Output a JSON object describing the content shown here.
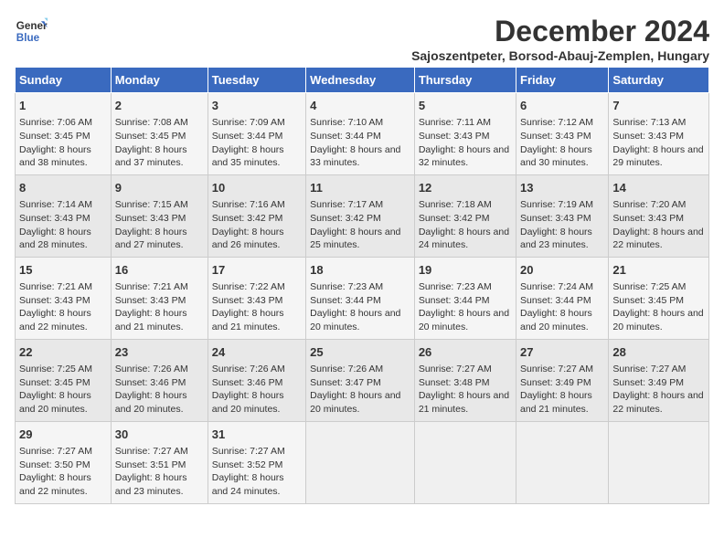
{
  "logo": {
    "line1": "General",
    "line2": "Blue"
  },
  "title": "December 2024",
  "subtitle": "Sajoszentpeter, Borsod-Abauj-Zemplen, Hungary",
  "days_of_week": [
    "Sunday",
    "Monday",
    "Tuesday",
    "Wednesday",
    "Thursday",
    "Friday",
    "Saturday"
  ],
  "weeks": [
    [
      {
        "day": 1,
        "sunrise": "7:06 AM",
        "sunset": "3:45 PM",
        "daylight": "8 hours and 38 minutes."
      },
      {
        "day": 2,
        "sunrise": "7:08 AM",
        "sunset": "3:45 PM",
        "daylight": "8 hours and 37 minutes."
      },
      {
        "day": 3,
        "sunrise": "7:09 AM",
        "sunset": "3:44 PM",
        "daylight": "8 hours and 35 minutes."
      },
      {
        "day": 4,
        "sunrise": "7:10 AM",
        "sunset": "3:44 PM",
        "daylight": "8 hours and 33 minutes."
      },
      {
        "day": 5,
        "sunrise": "7:11 AM",
        "sunset": "3:43 PM",
        "daylight": "8 hours and 32 minutes."
      },
      {
        "day": 6,
        "sunrise": "7:12 AM",
        "sunset": "3:43 PM",
        "daylight": "8 hours and 30 minutes."
      },
      {
        "day": 7,
        "sunrise": "7:13 AM",
        "sunset": "3:43 PM",
        "daylight": "8 hours and 29 minutes."
      }
    ],
    [
      {
        "day": 8,
        "sunrise": "7:14 AM",
        "sunset": "3:43 PM",
        "daylight": "8 hours and 28 minutes."
      },
      {
        "day": 9,
        "sunrise": "7:15 AM",
        "sunset": "3:43 PM",
        "daylight": "8 hours and 27 minutes."
      },
      {
        "day": 10,
        "sunrise": "7:16 AM",
        "sunset": "3:42 PM",
        "daylight": "8 hours and 26 minutes."
      },
      {
        "day": 11,
        "sunrise": "7:17 AM",
        "sunset": "3:42 PM",
        "daylight": "8 hours and 25 minutes."
      },
      {
        "day": 12,
        "sunrise": "7:18 AM",
        "sunset": "3:42 PM",
        "daylight": "8 hours and 24 minutes."
      },
      {
        "day": 13,
        "sunrise": "7:19 AM",
        "sunset": "3:43 PM",
        "daylight": "8 hours and 23 minutes."
      },
      {
        "day": 14,
        "sunrise": "7:20 AM",
        "sunset": "3:43 PM",
        "daylight": "8 hours and 22 minutes."
      }
    ],
    [
      {
        "day": 15,
        "sunrise": "7:21 AM",
        "sunset": "3:43 PM",
        "daylight": "8 hours and 22 minutes."
      },
      {
        "day": 16,
        "sunrise": "7:21 AM",
        "sunset": "3:43 PM",
        "daylight": "8 hours and 21 minutes."
      },
      {
        "day": 17,
        "sunrise": "7:22 AM",
        "sunset": "3:43 PM",
        "daylight": "8 hours and 21 minutes."
      },
      {
        "day": 18,
        "sunrise": "7:23 AM",
        "sunset": "3:44 PM",
        "daylight": "8 hours and 20 minutes."
      },
      {
        "day": 19,
        "sunrise": "7:23 AM",
        "sunset": "3:44 PM",
        "daylight": "8 hours and 20 minutes."
      },
      {
        "day": 20,
        "sunrise": "7:24 AM",
        "sunset": "3:44 PM",
        "daylight": "8 hours and 20 minutes."
      },
      {
        "day": 21,
        "sunrise": "7:25 AM",
        "sunset": "3:45 PM",
        "daylight": "8 hours and 20 minutes."
      }
    ],
    [
      {
        "day": 22,
        "sunrise": "7:25 AM",
        "sunset": "3:45 PM",
        "daylight": "8 hours and 20 minutes."
      },
      {
        "day": 23,
        "sunrise": "7:26 AM",
        "sunset": "3:46 PM",
        "daylight": "8 hours and 20 minutes."
      },
      {
        "day": 24,
        "sunrise": "7:26 AM",
        "sunset": "3:46 PM",
        "daylight": "8 hours and 20 minutes."
      },
      {
        "day": 25,
        "sunrise": "7:26 AM",
        "sunset": "3:47 PM",
        "daylight": "8 hours and 20 minutes."
      },
      {
        "day": 26,
        "sunrise": "7:27 AM",
        "sunset": "3:48 PM",
        "daylight": "8 hours and 21 minutes."
      },
      {
        "day": 27,
        "sunrise": "7:27 AM",
        "sunset": "3:49 PM",
        "daylight": "8 hours and 21 minutes."
      },
      {
        "day": 28,
        "sunrise": "7:27 AM",
        "sunset": "3:49 PM",
        "daylight": "8 hours and 22 minutes."
      }
    ],
    [
      {
        "day": 29,
        "sunrise": "7:27 AM",
        "sunset": "3:50 PM",
        "daylight": "8 hours and 22 minutes."
      },
      {
        "day": 30,
        "sunrise": "7:27 AM",
        "sunset": "3:51 PM",
        "daylight": "8 hours and 23 minutes."
      },
      {
        "day": 31,
        "sunrise": "7:27 AM",
        "sunset": "3:52 PM",
        "daylight": "8 hours and 24 minutes."
      },
      null,
      null,
      null,
      null
    ]
  ],
  "labels": {
    "sunrise": "Sunrise:",
    "sunset": "Sunset:",
    "daylight": "Daylight:"
  }
}
